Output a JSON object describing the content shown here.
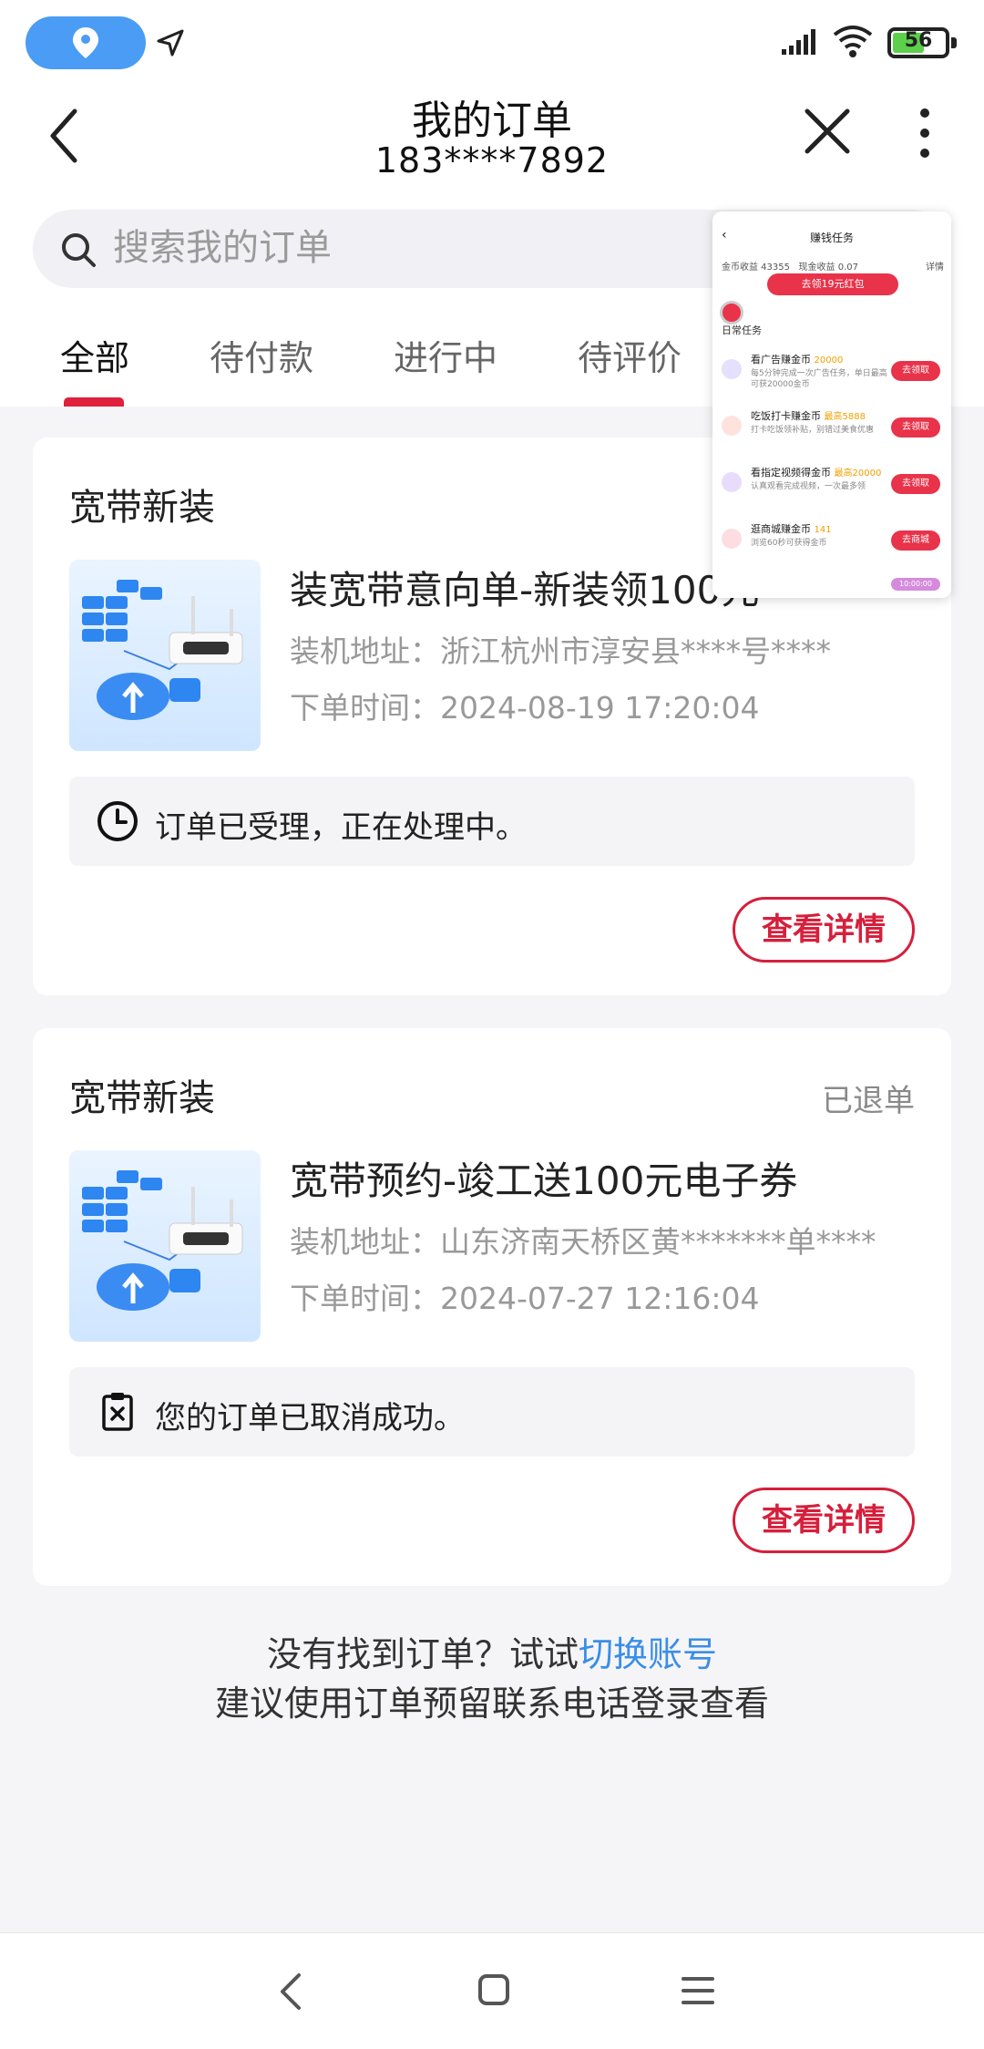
{
  "status_bar": {
    "battery": "56"
  },
  "header": {
    "title": "我的订单",
    "phone": "183****7892"
  },
  "search": {
    "placeholder": "搜索我的订单"
  },
  "tabs": [
    {
      "label": "全部",
      "active": true
    },
    {
      "label": "待付款",
      "active": false
    },
    {
      "label": "进行中",
      "active": false
    },
    {
      "label": "待评价",
      "active": false
    }
  ],
  "orders": [
    {
      "type": "宽带新装",
      "status": "",
      "name": "装宽带意向单-新装领100元",
      "address_label": "装机地址：",
      "address": "浙江杭州市淳安县****号****",
      "time_label": "下单时间：",
      "time": "2024-08-19 17:20:04",
      "notice": "订单已受理，正在处理中。",
      "button": "查看详情"
    },
    {
      "type": "宽带新装",
      "status": "已退单",
      "name": "宽带预约-竣工送100元电子券",
      "address_label": "装机地址：",
      "address": "山东济南天桥区黄*******单****",
      "time_label": "下单时间：",
      "time": "2024-07-27 12:16:04",
      "notice": "您的订单已取消成功。",
      "button": "查看详情"
    }
  ],
  "footer_hint": {
    "prefix": "没有找到订单？试试",
    "link": "切换账号",
    "line2": "建议使用订单预留联系电话登录查看"
  },
  "overlay": {
    "title": "赚钱任务",
    "coins": "金币收益 43355",
    "cash": "现金收益 0.07",
    "detail": "详情",
    "red_button": "去领19元红包",
    "daily": "日常任务",
    "tasks": [
      {
        "name": "看广告赚金币",
        "coin": "20000",
        "desc": "每5分钟完成一次广告任务，单日最高可获20000金币",
        "button": "去领取",
        "color": "#7b6cf6"
      },
      {
        "name": "吃饭打卡赚金币",
        "coin": "最高5888",
        "desc": "打卡吃饭领补贴，别错过美食优惠",
        "button": "去领取",
        "color": "#f26b5b"
      },
      {
        "name": "看指定视频得金币",
        "coin": "最高20000",
        "desc": "认真观看完成视频，一次最多领",
        "button": "去领取",
        "color": "#8a5cf0"
      },
      {
        "name": "逛商城赚金币",
        "coin": "141",
        "desc": "浏览60秒可获得金币",
        "button": "去商城",
        "color": "#e8334a"
      }
    ],
    "pink_badge": "10:00:00"
  },
  "colors": {
    "accent": "#e01f3d",
    "link": "#3a8ee6",
    "location_pill": "#4a9cf5"
  }
}
